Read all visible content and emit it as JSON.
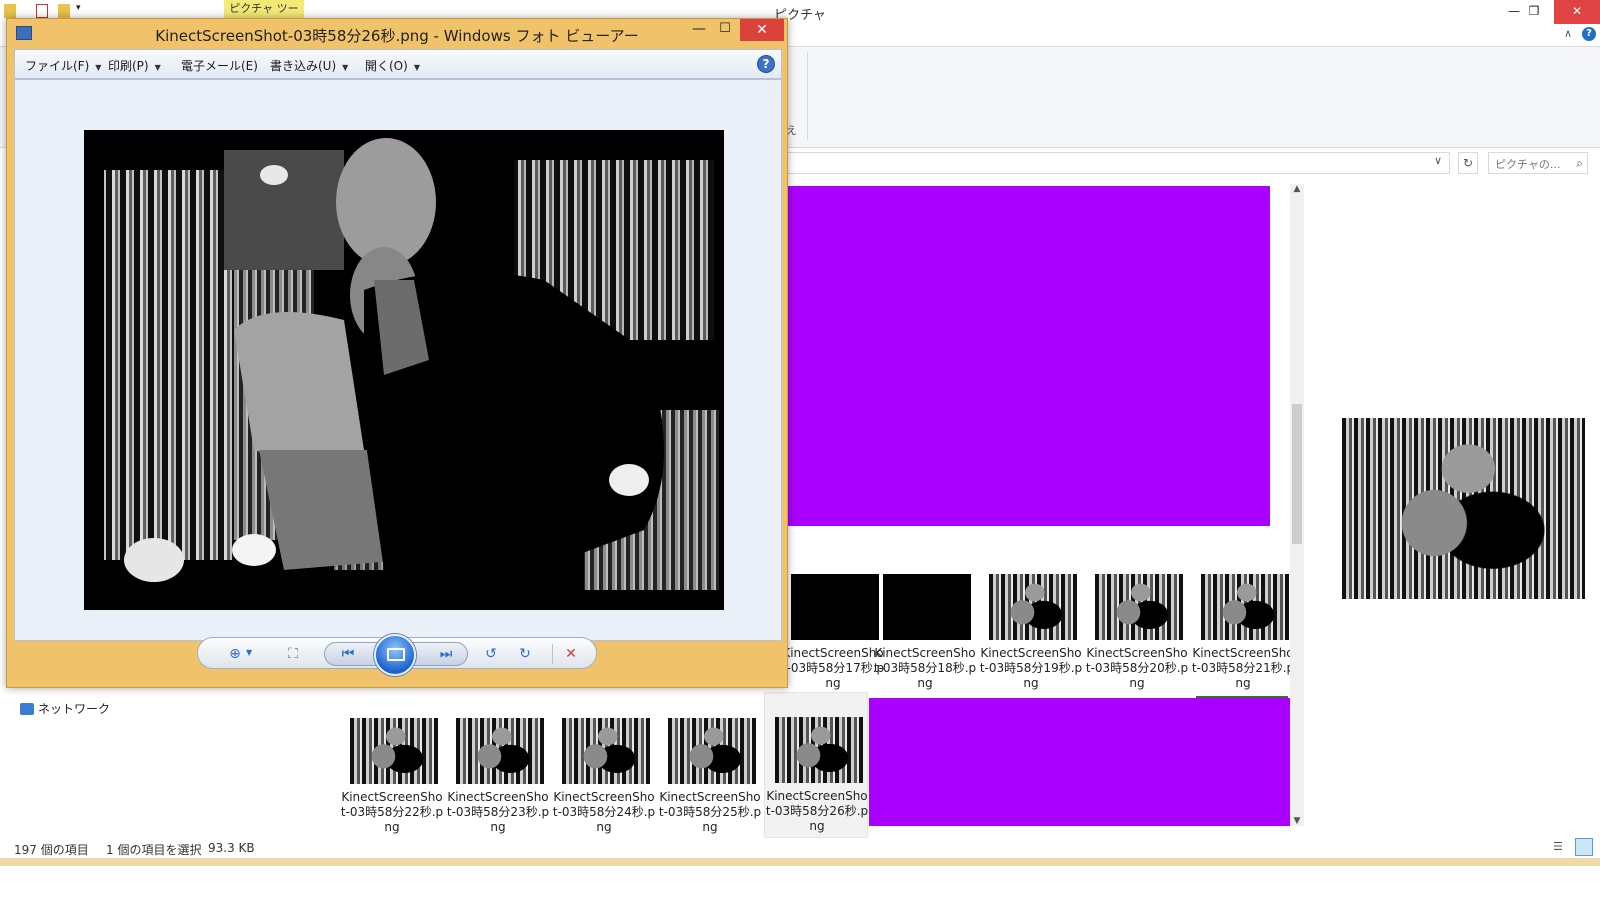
{
  "explorer": {
    "title": "ピクチャ",
    "tool_tab": "ピクチャ ツール",
    "window_controls": {
      "minimize": "—",
      "restore": "❐",
      "close": "✕"
    },
    "ribbon": {
      "collapse_glyph": "∧",
      "help_glyph": "?",
      "partial_text": "え"
    },
    "address": {
      "dropdown_glyph": "∨",
      "refresh_glyph": "↻"
    },
    "search": {
      "placeholder": "ピクチャの...",
      "icon": "search-icon"
    },
    "nav": {
      "network_label": "ネットワーク"
    },
    "files_row1": [
      {
        "name": "KinectScreenShot-03時58分17秒.png",
        "thumb": "black"
      },
      {
        "name": "KinectScreenShot-03時58分18秒.png",
        "thumb": "black"
      },
      {
        "name": "KinectScreenShot-03時58分19秒.png",
        "thumb": "depth"
      },
      {
        "name": "KinectScreenShot-03時58分20秒.png",
        "thumb": "depth"
      },
      {
        "name": "KinectScreenShot-03時58分21秒.png",
        "thumb": "depth"
      }
    ],
    "files_row2": [
      {
        "name": "KinectScreenShot-03時58分22秒.png",
        "thumb": "depth"
      },
      {
        "name": "KinectScreenShot-03時58分23秒.png",
        "thumb": "depth"
      },
      {
        "name": "KinectScreenShot-03時58分24秒.png",
        "thumb": "depth"
      },
      {
        "name": "KinectScreenShot-03時58分25秒.png",
        "thumb": "depth"
      },
      {
        "name": "KinectScreenShot-03時58分26秒.png",
        "thumb": "depth",
        "selected": true
      }
    ],
    "status": {
      "item_count": "197 個の項目",
      "selected": "1 個の項目を選択",
      "size": "93.3 KB"
    },
    "colors": {
      "redaction": "#a900ff",
      "selection": "#f2f2f2"
    }
  },
  "viewer": {
    "title": "KinectScreenShot-03時58分26秒.png - Windows フォト ビューアー",
    "window_controls": {
      "minimize": "—",
      "maximize": "☐",
      "close": "✕"
    },
    "menu": [
      {
        "label": "ファイル(F)",
        "has_dropdown": true
      },
      {
        "label": "印刷(P)",
        "has_dropdown": true
      },
      {
        "label": "電子メール(E)",
        "has_dropdown": false
      },
      {
        "label": "書き込み(U)",
        "has_dropdown": true
      },
      {
        "label": "開く(O)",
        "has_dropdown": true
      }
    ],
    "help_glyph": "?",
    "toolbar": {
      "zoom_glyph": "⊕",
      "fit_glyph": "⛶",
      "prev_glyph": "⏮",
      "next_glyph": "⏭",
      "rotate_ccw_glyph": "↺",
      "rotate_cw_glyph": "↻",
      "delete_glyph": "✕"
    },
    "colors": {
      "frame": "#f0c36a",
      "canvas": "#eaf0f8",
      "accent": "#1c64cc"
    }
  }
}
